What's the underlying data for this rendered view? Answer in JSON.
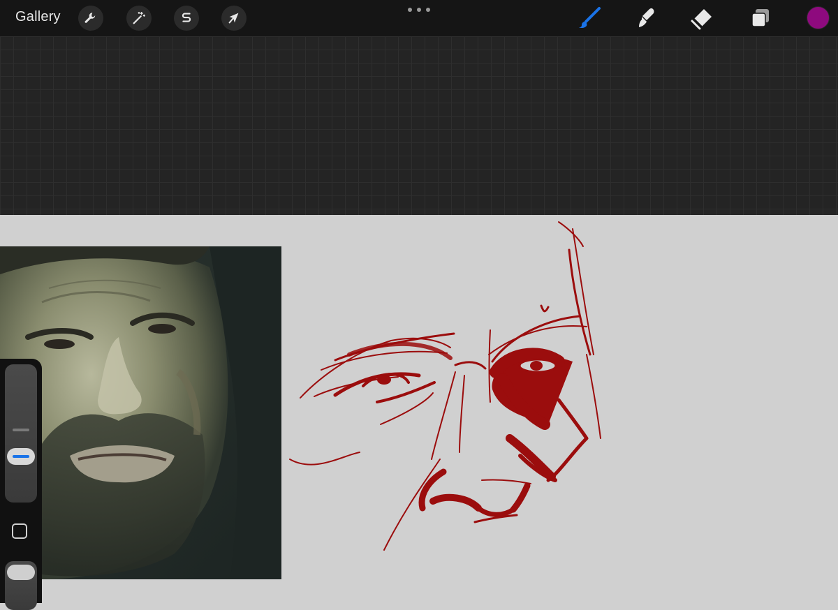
{
  "topbar": {
    "gallery_label": "Gallery",
    "tools_left": [
      {
        "name": "wrench-icon",
        "meaning": "actions"
      },
      {
        "name": "magic-wand-icon",
        "meaning": "adjustments"
      },
      {
        "name": "selection-s-icon",
        "meaning": "selection"
      },
      {
        "name": "transform-arrow-icon",
        "meaning": "transform"
      }
    ],
    "tools_right": [
      {
        "name": "brush-icon",
        "active": true
      },
      {
        "name": "smudge-icon",
        "active": false
      },
      {
        "name": "eraser-icon",
        "active": false
      },
      {
        "name": "layers-icon",
        "active": false
      }
    ],
    "active_color": "#8e0a7e"
  },
  "colors": {
    "topbar_bg": "#151515",
    "grid_bg": "#242424",
    "canvas_bg": "#d0d0d0",
    "sketch_stroke": "#9b0d0d",
    "accent": "#1a73e8"
  },
  "sidebar": {
    "brush_size_level": 0.35,
    "opacity_level": 1.0
  }
}
